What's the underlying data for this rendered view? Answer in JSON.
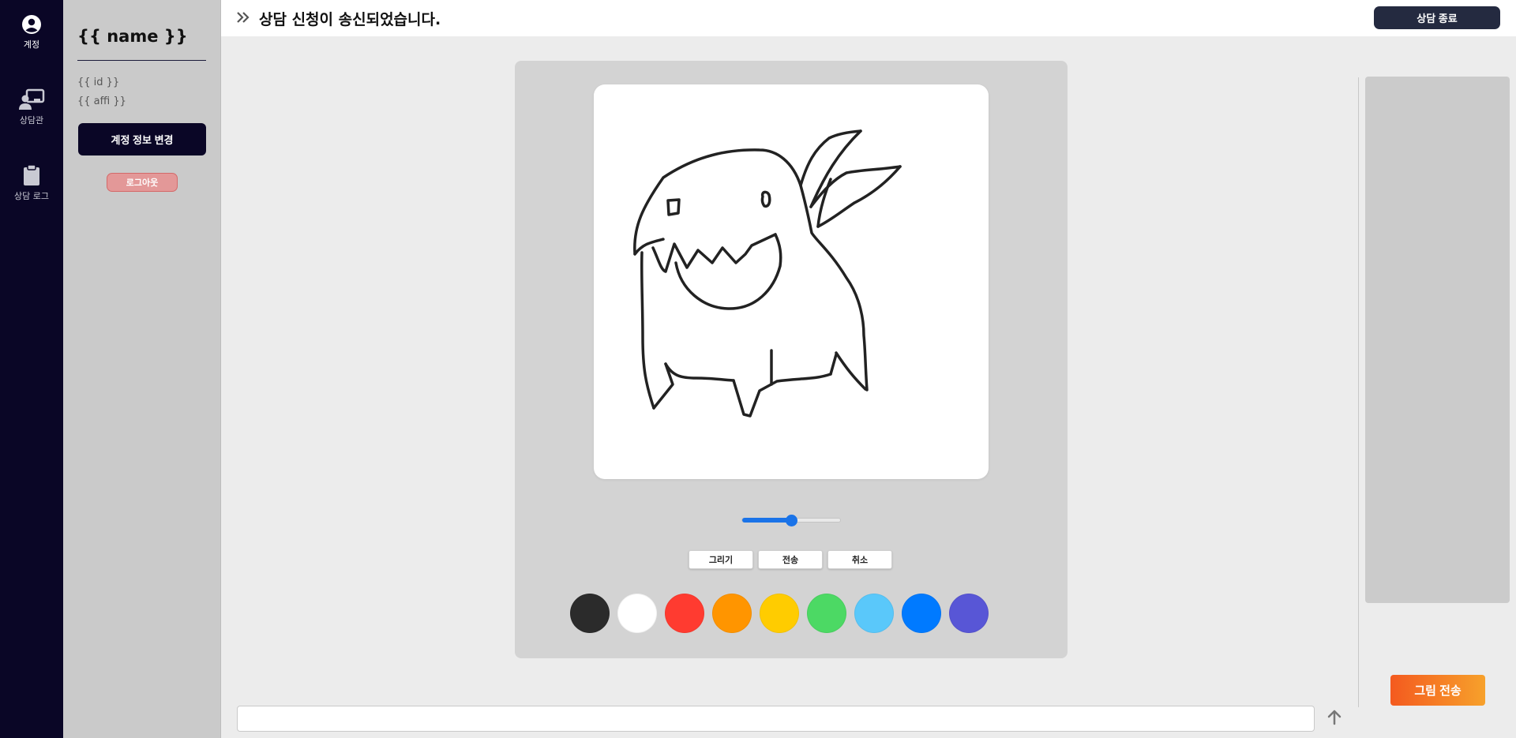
{
  "nav": {
    "items": [
      {
        "label": "계정",
        "icon": "user-circle-icon"
      },
      {
        "label": "상담관",
        "icon": "counselor-icon"
      },
      {
        "label": "상담 로그",
        "icon": "clipboard-icon"
      }
    ]
  },
  "account": {
    "name": "{{ name }}",
    "id": "{{ id }}",
    "affi": "{{ affi }}",
    "edit_label": "계정 정보 변경",
    "logout_label": "로그아웃"
  },
  "header": {
    "title": "상담 신청이 송신되었습니다.",
    "end_label": "상담 종료"
  },
  "canvas": {
    "brush_level": 0.5,
    "tools": {
      "draw": "그리기",
      "send": "전송",
      "cancel": "취소"
    },
    "palette": [
      "#2b2b2b",
      "#ffffff",
      "#ff3b30",
      "#ff9500",
      "#ffcc00",
      "#4cd964",
      "#5ac8fa",
      "#007aff",
      "#5856d6"
    ]
  },
  "side": {
    "send_image_label": "그림 전송"
  },
  "chat": {
    "input_value": "",
    "placeholder": ""
  }
}
